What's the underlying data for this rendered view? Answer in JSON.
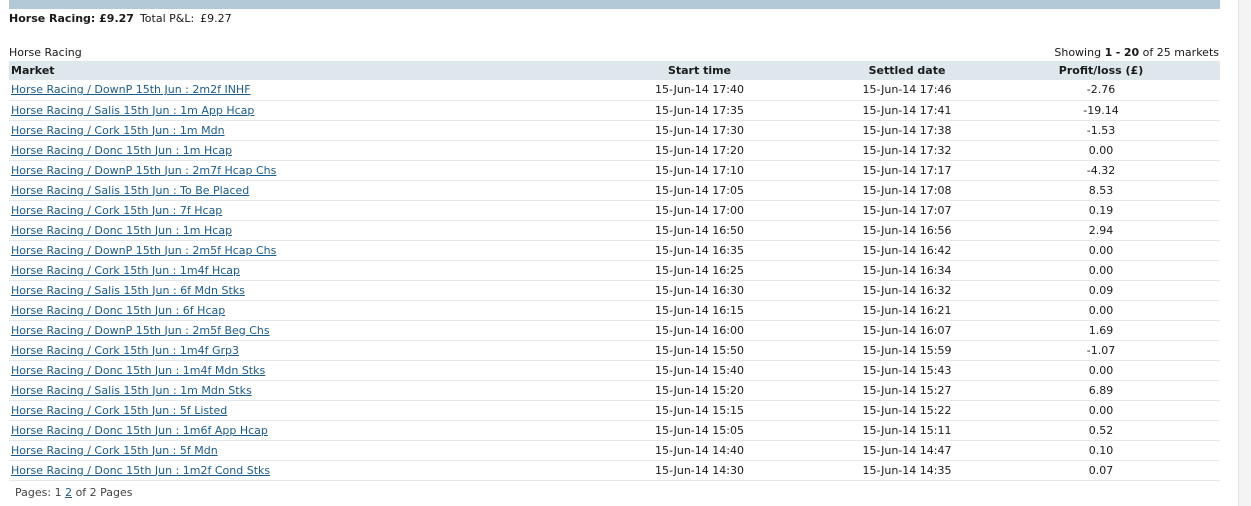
{
  "summary": {
    "label": "Horse Racing: £9.27",
    "total_label": "Total P&L:",
    "total_value": "£9.27"
  },
  "section_title": "Horse Racing",
  "showing": {
    "prefix": "Showing",
    "from": "1",
    "sep": "-",
    "to": "20",
    "suffix": "of 25 markets"
  },
  "table": {
    "headers": {
      "market": "Market",
      "start": "Start time",
      "settled": "Settled date",
      "pl": "Profit/loss (£)"
    },
    "rows": [
      {
        "market": "Horse Racing / DownP 15th Jun : 2m2f INHF",
        "start": "15-Jun-14 17:40",
        "settled": "15-Jun-14 17:46",
        "pl": "-2.76"
      },
      {
        "market": "Horse Racing / Salis 15th Jun : 1m App Hcap",
        "start": "15-Jun-14 17:35",
        "settled": "15-Jun-14 17:41",
        "pl": "-19.14"
      },
      {
        "market": "Horse Racing / Cork 15th Jun : 1m Mdn",
        "start": "15-Jun-14 17:30",
        "settled": "15-Jun-14 17:38",
        "pl": "-1.53"
      },
      {
        "market": "Horse Racing / Donc 15th Jun : 1m Hcap",
        "start": "15-Jun-14 17:20",
        "settled": "15-Jun-14 17:32",
        "pl": "0.00"
      },
      {
        "market": "Horse Racing / DownP 15th Jun : 2m7f Hcap Chs",
        "start": "15-Jun-14 17:10",
        "settled": "15-Jun-14 17:17",
        "pl": "-4.32"
      },
      {
        "market": "Horse Racing / Salis 15th Jun : To Be Placed",
        "start": "15-Jun-14 17:05",
        "settled": "15-Jun-14 17:08",
        "pl": "8.53"
      },
      {
        "market": "Horse Racing / Cork 15th Jun : 7f Hcap",
        "start": "15-Jun-14 17:00",
        "settled": "15-Jun-14 17:07",
        "pl": "0.19"
      },
      {
        "market": "Horse Racing / Donc 15th Jun : 1m Hcap",
        "start": "15-Jun-14 16:50",
        "settled": "15-Jun-14 16:56",
        "pl": "2.94"
      },
      {
        "market": "Horse Racing / DownP 15th Jun : 2m5f Hcap Chs",
        "start": "15-Jun-14 16:35",
        "settled": "15-Jun-14 16:42",
        "pl": "0.00"
      },
      {
        "market": "Horse Racing / Cork 15th Jun : 1m4f Hcap",
        "start": "15-Jun-14 16:25",
        "settled": "15-Jun-14 16:34",
        "pl": "0.00"
      },
      {
        "market": "Horse Racing / Salis 15th Jun : 6f Mdn Stks",
        "start": "15-Jun-14 16:30",
        "settled": "15-Jun-14 16:32",
        "pl": "0.09"
      },
      {
        "market": "Horse Racing / Donc 15th Jun : 6f Hcap",
        "start": "15-Jun-14 16:15",
        "settled": "15-Jun-14 16:21",
        "pl": "0.00"
      },
      {
        "market": "Horse Racing / DownP 15th Jun : 2m5f Beg Chs",
        "start": "15-Jun-14 16:00",
        "settled": "15-Jun-14 16:07",
        "pl": "1.69"
      },
      {
        "market": "Horse Racing / Cork 15th Jun : 1m4f Grp3",
        "start": "15-Jun-14 15:50",
        "settled": "15-Jun-14 15:59",
        "pl": "-1.07"
      },
      {
        "market": "Horse Racing / Donc 15th Jun : 1m4f Mdn Stks",
        "start": "15-Jun-14 15:40",
        "settled": "15-Jun-14 15:43",
        "pl": "0.00"
      },
      {
        "market": "Horse Racing / Salis 15th Jun : 1m Mdn Stks",
        "start": "15-Jun-14 15:20",
        "settled": "15-Jun-14 15:27",
        "pl": "6.89"
      },
      {
        "market": "Horse Racing / Cork 15th Jun : 5f Listed",
        "start": "15-Jun-14 15:15",
        "settled": "15-Jun-14 15:22",
        "pl": "0.00"
      },
      {
        "market": "Horse Racing / Donc 15th Jun : 1m6f App Hcap",
        "start": "15-Jun-14 15:05",
        "settled": "15-Jun-14 15:11",
        "pl": "0.52"
      },
      {
        "market": "Horse Racing / Cork 15th Jun : 5f Mdn",
        "start": "15-Jun-14 14:40",
        "settled": "15-Jun-14 14:47",
        "pl": "0.10"
      },
      {
        "market": "Horse Racing / Donc 15th Jun : 1m2f Cond Stks",
        "start": "15-Jun-14 14:30",
        "settled": "15-Jun-14 14:35",
        "pl": "0.07"
      }
    ]
  },
  "pager": {
    "label": "Pages:",
    "current": "1",
    "next": "2",
    "total": "of 2 Pages"
  }
}
